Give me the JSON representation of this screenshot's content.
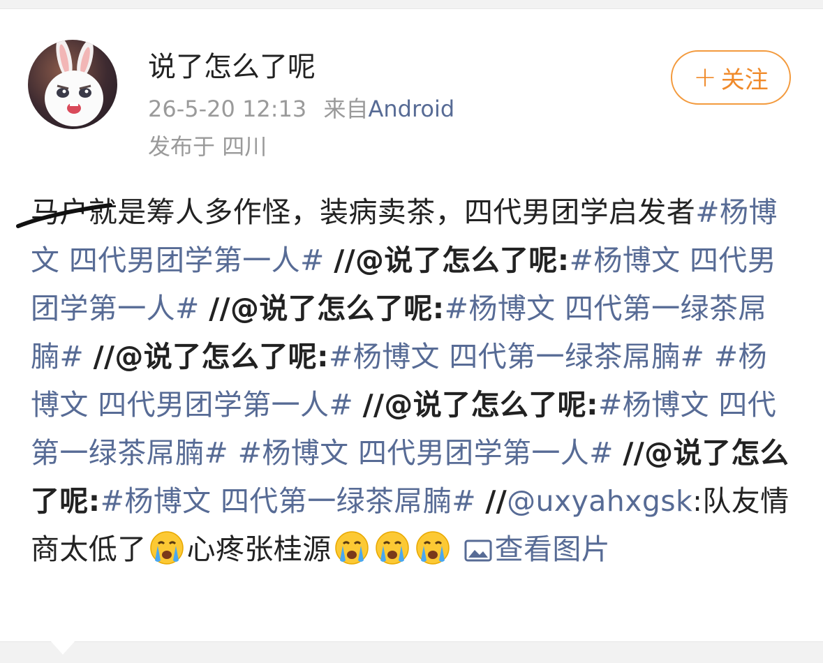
{
  "post": {
    "username": "说了怎么了呢",
    "timestamp": "26-5-20 12:13",
    "from_label": "来自",
    "source": "Android",
    "location_label": "发布于",
    "location": "四川",
    "follow_label": "关注",
    "follow_plus": "+",
    "avatar_icon": "bunny-avatar-icon"
  },
  "content": {
    "struck_text": "马户",
    "intro": "就是筹人多作怪，装病卖茶，四代男团学启发者",
    "tag1": "#杨博文 四代男团学第一人#",
    "repost1": "//@说了怎么了呢:",
    "tag2": "#杨博文 四代男团学第一人#",
    "repost2": "//@说了怎么了呢:",
    "tag3": "#杨博文 四代第一绿茶屌腩#",
    "repost3": "//@说了怎么了呢:",
    "tag4": "#杨博文 四代第一绿茶屌腩#",
    "tag5": "#杨博文 四代男团学第一人#",
    "repost4": "//@说了怎么了呢:",
    "tag6": "#杨博文 四代第一绿茶屌腩#",
    "tag7": "#杨博文 四代男团学第一人#",
    "repost5": "//@说了怎么了呢:",
    "tag8": "#杨博文 四代第一绿茶屌腩#",
    "repost6_prefix": "//",
    "repost6_user": "@uxyahxgsk",
    "repost6_colon": ":",
    "repost6_text": "队友情商太低了",
    "tail_text": "心疼张桂源",
    "view_image": "查看图片",
    "emoji_icons": [
      "crying-face-icon",
      "crying-face-icon",
      "crying-face-icon",
      "crying-face-icon"
    ],
    "image_icon": "image-icon"
  },
  "colors": {
    "link": "#576b95",
    "follow": "#f08a2a",
    "meta": "#9a9a9a",
    "text": "#222222"
  }
}
